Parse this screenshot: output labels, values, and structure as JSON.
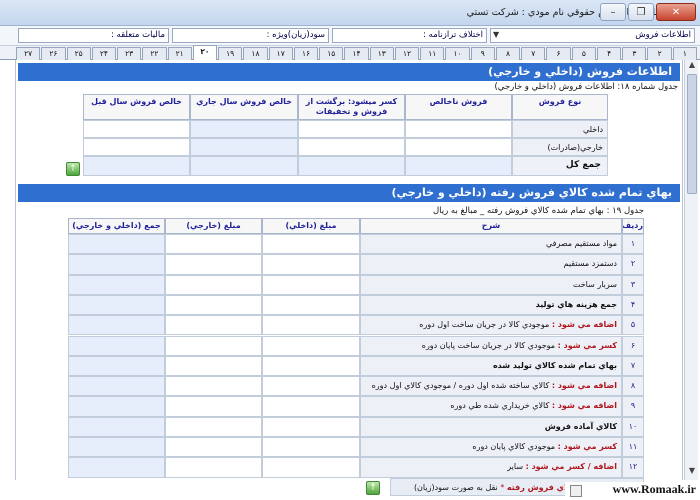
{
  "titlebar": {
    "title": "اظهارنامه اشخاص حقوقي   نام مودي : شركت تستي"
  },
  "fields": {
    "sales_type": "اطلاعات فروش",
    "balance_diff": "اختلاف ترازنامه :",
    "profit_special": "سود(زيان)ويژه :",
    "tax_due": "ماليات متعلقه :"
  },
  "tabs": [
    "۴",
    "۳",
    "۲",
    "۱",
    "۴",
    "۵",
    "۶",
    "۷",
    "۸",
    "۹",
    "۱۰",
    "۱۱",
    "۱۲",
    "۱۳",
    "۱۴",
    "۱۵",
    "۱۶",
    "۱۷",
    "۱۸",
    "۱۹",
    "۲۰",
    "۲۱",
    "۲۲",
    "۲۳",
    "۲۴",
    "۲۵",
    "۲۶",
    "۲۷"
  ],
  "tab_labels": [
    "۱",
    "۲",
    "۳",
    "۴",
    "۵",
    "۶",
    "۷",
    "۸",
    "۹",
    "۱۰",
    "۱۱",
    "۱۲",
    "۱۳",
    "۱۴",
    "۱۵",
    "۱۶",
    "۱۷",
    "۱۸",
    "۱۹",
    "۲۰",
    "۲۱",
    "۲۲",
    "۲۳",
    "۲۴",
    "۲۵",
    "۲۶",
    "۲۷"
  ],
  "active_tab": "۲۰",
  "section1": {
    "title": "اطلاعات فروش (داخلي و خارجي)",
    "caption": "جدول شماره ۱۸: اطلاعات فروش (داخلي و خارجي)",
    "headers": {
      "type": "نوع فروش",
      "gross": "فروش ناخالص",
      "returns": "كسر ميشود: برگشت از فروش و تخفيفات",
      "net_current": "خالص فروش سال جاري",
      "net_prev": "خالص فروش سال قبل"
    },
    "rows": [
      "داخلي",
      "خارجي(صادرات)"
    ],
    "total_label": "جمع كل"
  },
  "section2": {
    "title": "بهاي تمام شده كالاي فروش رفته (داخلي و خارجي)",
    "caption": "جدول ۱۹ : بهاي تمام شده كالاي فروش رفته _ مبالغ به ريال",
    "headers": {
      "row": "رديف",
      "desc": "شرح",
      "internal": "مبلغ (داخلي)",
      "external": "مبلغ (خارجي)",
      "total": "جمع (داخلي و خارجي)"
    },
    "rows": [
      {
        "n": "۱",
        "prefix": "",
        "text": "مواد مستقيم مصرفي",
        "bold": false
      },
      {
        "n": "۲",
        "prefix": "",
        "text": "دستمزد مستقيم",
        "bold": false
      },
      {
        "n": "۳",
        "prefix": "",
        "text": "سربار ساخت",
        "bold": false
      },
      {
        "n": "۴",
        "prefix": "",
        "text": "جمع هزينه هاي توليد",
        "bold": true
      },
      {
        "n": "۵",
        "prefix": "اضافه مي شود :",
        "text": "موجودي كالا در جريان ساخت اول دوره",
        "bold": false
      },
      {
        "n": "۶",
        "prefix": "كسر مي شود :",
        "text": "موجودي كالا در جريان ساخت پايان دوره",
        "bold": false
      },
      {
        "n": "۷",
        "prefix": "",
        "text": "بهاي تمام شده كالاي توليد شده",
        "bold": true
      },
      {
        "n": "۸",
        "prefix": "اضافه مي شود :",
        "text": "كالاي ساخته شده اول دوره / موجودي كالاي اول دوره",
        "bold": false
      },
      {
        "n": "۹",
        "prefix": "اضافه مي شود :",
        "text": "كالاي خريداري شده طي دوره",
        "bold": false
      },
      {
        "n": "۱۰",
        "prefix": "",
        "text": "كالاي آماده فروش",
        "bold": true
      },
      {
        "n": "۱۱",
        "prefix": "كسر مي شود :",
        "text": "موجودي كالاي پايان دوره",
        "bold": false
      },
      {
        "n": "۱۲",
        "prefix": "اضافه / كسر مي شود :",
        "text": "ساير",
        "bold": false
      }
    ],
    "footer_label": "بهاي تمام شده كالاي فروش رفته",
    "footer_note": "نقل به صورت سود(زيان)"
  },
  "watermark": "www.Romaak.ir"
}
